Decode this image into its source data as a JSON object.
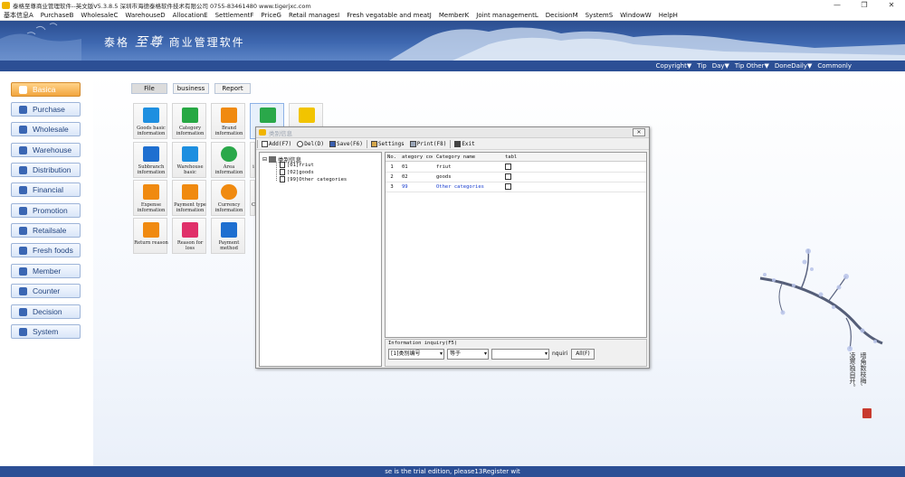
{
  "window": {
    "title": "泰格至尊商业管理软件--英文版V5.3.8.5    深圳市海德泰格软件技术有限公司    0755-83461480    www.tigerjxc.com",
    "controls": [
      "—",
      "❐",
      "✕"
    ]
  },
  "menubar": [
    "基本信息A",
    "PurchaseB",
    "WholesaleC",
    "WarehouseD",
    "AllocationE",
    "SettlementF",
    "PriceG",
    "Retail managesI",
    "Fresh vegatable and meatJ",
    "MemberK",
    "Joint managementL",
    "DecisionM",
    "SystemS",
    "WindowW",
    "HelpH"
  ],
  "banner": {
    "brand": "泰格",
    "logo": "至尊",
    "suffix": "商业管理软件"
  },
  "topstrip": [
    "Copyright▼",
    "Tip",
    "Day▼",
    "Tip Other▼",
    "DoneDaily▼",
    "Commonly"
  ],
  "nav": [
    {
      "label": "Basica",
      "icon": "home-icon",
      "active": true
    },
    {
      "label": "Purchase",
      "icon": "cart-icon"
    },
    {
      "label": "Wholesale",
      "icon": "box-icon"
    },
    {
      "label": "Warehouse",
      "icon": "warehouse-icon"
    },
    {
      "label": "Distribution",
      "icon": "truck-icon"
    },
    {
      "label": "Financial",
      "icon": "ledger-icon"
    },
    {
      "label": "Promotion",
      "icon": "tag-icon"
    },
    {
      "label": "Retailsale",
      "icon": "register-icon"
    },
    {
      "label": "Fresh foods",
      "icon": "leaf-icon"
    },
    {
      "label": "Member",
      "icon": "card-icon"
    },
    {
      "label": "Counter",
      "icon": "counter-icon"
    },
    {
      "label": "Decision",
      "icon": "chart-icon"
    },
    {
      "label": "System",
      "icon": "gear-icon"
    }
  ],
  "tabs": [
    {
      "label": "File",
      "active": true
    },
    {
      "label": "business"
    },
    {
      "label": "Report"
    }
  ],
  "modules": [
    {
      "label": "Goods basic information",
      "icon": "bag-icon",
      "color": "#1e8fe0"
    },
    {
      "label": "Category information",
      "icon": "category-icon",
      "color": "#27a844"
    },
    {
      "label": "Brand information",
      "icon": "crown-icon",
      "color": "#f08a10"
    },
    {
      "label": "",
      "icon": "org-tree-icon",
      "color": "#2aa84a",
      "selected": true
    },
    {
      "label": "",
      "icon": "package-icon",
      "color": "#f2c400"
    },
    {
      "label": "Subbranch information",
      "icon": "shop-icon",
      "color": "#1e6fd0"
    },
    {
      "label": "Warehouse basic",
      "icon": "house-icon",
      "color": "#1e8fe0"
    },
    {
      "label": "Area information",
      "icon": "globe-icon",
      "color": "#2aa84a"
    },
    {
      "label": "i",
      "icon": "unknown-icon",
      "color": "#1e8fe0"
    },
    {
      "label": "Expense information",
      "icon": "expense-icon",
      "color": "#f08a10"
    },
    {
      "label": "Payment type information",
      "icon": "wallet-icon",
      "color": "#f08a10"
    },
    {
      "label": "Currency information",
      "icon": "currency-icon",
      "color": "#f08a10"
    },
    {
      "label": "C",
      "icon": "unknown-icon",
      "color": "#1e8fe0"
    },
    {
      "label": "Return reason",
      "icon": "return-icon",
      "color": "#f08a10"
    },
    {
      "label": "Reason for loss",
      "icon": "loss-icon",
      "color": "#e0306a"
    },
    {
      "label": "Payment method",
      "icon": "envelope-icon",
      "color": "#1e6fd0"
    }
  ],
  "dialog": {
    "title": "类别信息",
    "close": "✕",
    "toolbar": [
      "Add(F7)",
      "Del(D)",
      "Save(F6)",
      "Settings",
      "Print(F8)",
      "Exit"
    ],
    "tree": {
      "root": "类别信息",
      "children": [
        "[01]friut",
        "[02]goods",
        "[99]Other categories"
      ]
    },
    "grid": {
      "headers": [
        "No.",
        "ategory cod",
        "Category name",
        "tabl"
      ],
      "rows": [
        {
          "no": "1",
          "code": "01",
          "name": "friut",
          "blue": false
        },
        {
          "no": "2",
          "code": "02",
          "name": "goods",
          "blue": false
        },
        {
          "no": "3",
          "code": "99",
          "name": "Other categories",
          "blue": true
        }
      ]
    },
    "query": {
      "label": "Information inquiry(F5)",
      "field": "[1]类别编号",
      "operator": "等于",
      "value": "",
      "suffix": "nquiri",
      "button": "All(F)"
    }
  },
  "poem": [
    "墙角数枝梅,",
    "凌寒独自开。"
  ],
  "status": "se is the trial edition, please13Register wit"
}
